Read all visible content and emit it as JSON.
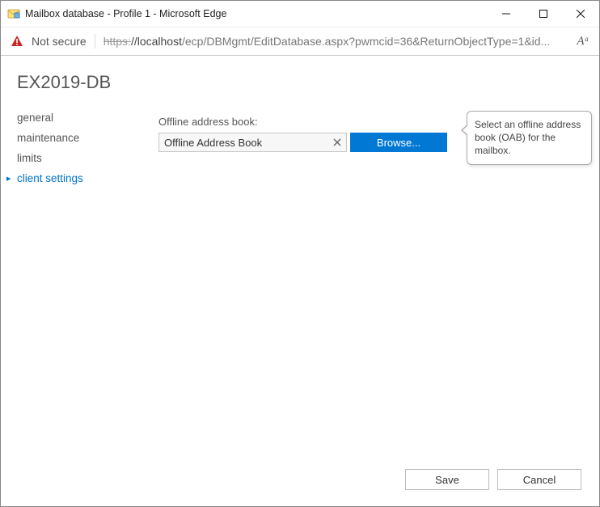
{
  "window": {
    "title": "Mailbox database - Profile 1 - Microsoft Edge"
  },
  "addressBar": {
    "securityLabel": "Not secure",
    "urlScheme": "https:",
    "urlHost": "//localhost",
    "urlPath": "/ecp/DBMgmt/EditDatabase.aspx?pwmcid=36&ReturnObjectType=1&id...",
    "readerGlyph": "Aᵃ"
  },
  "page": {
    "title": "EX2019-DB"
  },
  "sidebar": {
    "items": [
      {
        "label": "general"
      },
      {
        "label": "maintenance"
      },
      {
        "label": "limits"
      },
      {
        "label": "client settings"
      }
    ]
  },
  "main": {
    "oabFieldLabel": "Offline address book:",
    "oabValue": "Offline Address Book",
    "browseLabel": "Browse...",
    "calloutText": "Select an offline address book (OAB) for the mailbox."
  },
  "footer": {
    "saveLabel": "Save",
    "cancelLabel": "Cancel"
  }
}
